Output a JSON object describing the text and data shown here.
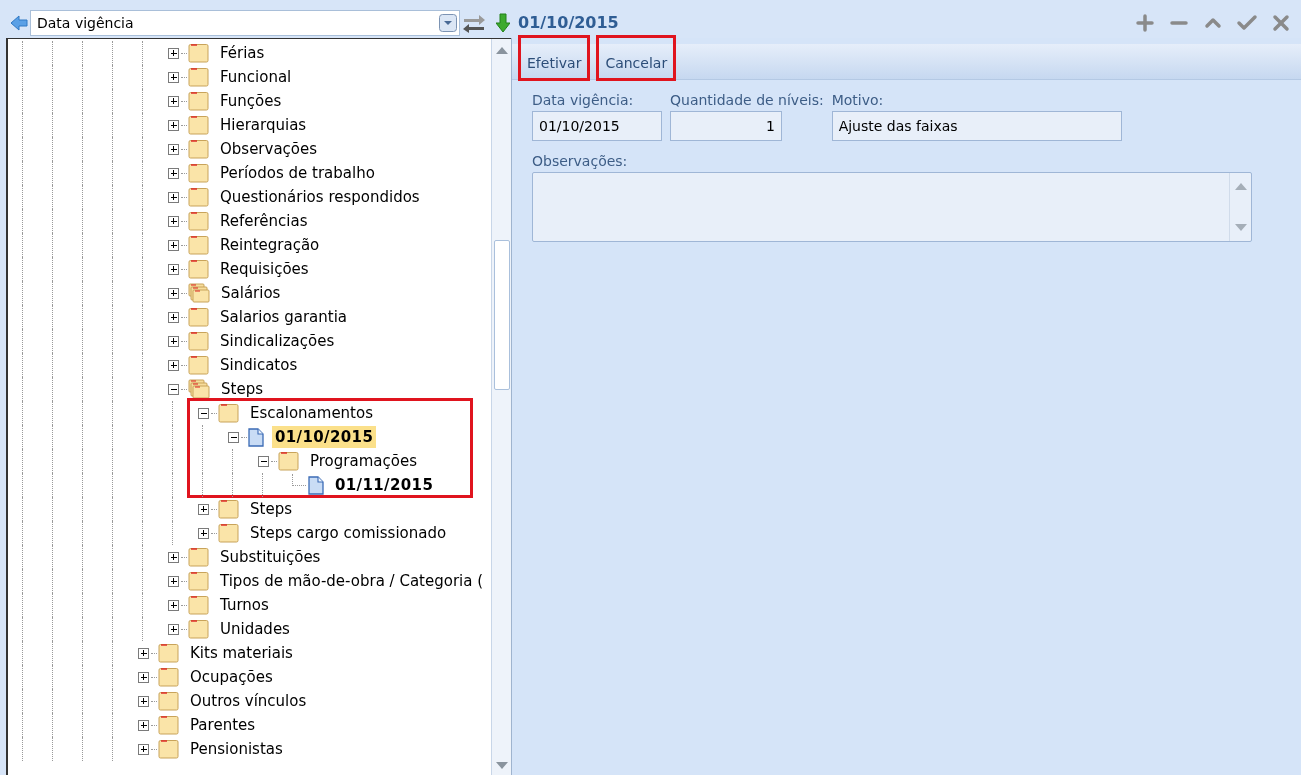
{
  "top_bar": {
    "combo_value": "Data vigência",
    "record_title": "01/10/2015"
  },
  "tree": {
    "continued_children": [
      {
        "label": "Férias",
        "kind": "folder",
        "expanded": false,
        "selected": false
      },
      {
        "label": "Funcional",
        "kind": "folder",
        "expanded": false,
        "selected": false
      },
      {
        "label": "Funções",
        "kind": "folder",
        "expanded": false,
        "selected": false
      },
      {
        "label": "Hierarquias",
        "kind": "folder",
        "expanded": false,
        "selected": false
      },
      {
        "label": "Observações",
        "kind": "folder",
        "expanded": false,
        "selected": false
      },
      {
        "label": "Períodos de trabalho",
        "kind": "folder",
        "expanded": false,
        "selected": false
      },
      {
        "label": "Questionários respondidos",
        "kind": "folder",
        "expanded": false,
        "selected": false
      },
      {
        "label": "Referências",
        "kind": "folder",
        "expanded": false,
        "selected": false
      },
      {
        "label": "Reintegração",
        "kind": "folder",
        "expanded": false,
        "selected": false
      },
      {
        "label": "Requisições",
        "kind": "folder",
        "expanded": false,
        "selected": false
      },
      {
        "label": "Salários",
        "kind": "folders",
        "expanded": false,
        "selected": false
      },
      {
        "label": "Salarios garantia",
        "kind": "folder",
        "expanded": false,
        "selected": false
      },
      {
        "label": "Sindicalizações",
        "kind": "folder",
        "expanded": false,
        "selected": false
      },
      {
        "label": "Sindicatos",
        "kind": "folder",
        "expanded": false,
        "selected": false
      },
      {
        "label": "Steps",
        "kind": "folders",
        "expanded": true,
        "selected": false,
        "children": [
          {
            "label": "Escalonamentos",
            "kind": "folder",
            "expanded": true,
            "selected": false,
            "annotated": true,
            "children": [
              {
                "label": "01/10/2015",
                "kind": "document",
                "expanded": true,
                "selected": true,
                "children": [
                  {
                    "label": "Programações",
                    "kind": "folder",
                    "expanded": true,
                    "selected": false,
                    "children": [
                      {
                        "label": "01/11/2015",
                        "kind": "document",
                        "selected": false
                      }
                    ]
                  }
                ]
              }
            ]
          },
          {
            "label": "Steps",
            "kind": "folder",
            "expanded": false,
            "selected": false
          },
          {
            "label": "Steps cargo comissionado",
            "kind": "folder",
            "expanded": false,
            "selected": false
          }
        ]
      },
      {
        "label": "Substituições",
        "kind": "folder",
        "expanded": false,
        "selected": false
      },
      {
        "label": "Tipos de mão-de-obra / Categoria (",
        "kind": "folder",
        "expanded": false,
        "selected": false
      },
      {
        "label": "Turnos",
        "kind": "folder",
        "expanded": false,
        "selected": false
      },
      {
        "label": "Unidades",
        "kind": "folder",
        "expanded": false,
        "selected": false
      }
    ],
    "items": [
      {
        "label": "Kits materiais",
        "kind": "folder",
        "expanded": false,
        "selected": false
      },
      {
        "label": "Ocupações",
        "kind": "folder",
        "expanded": false,
        "selected": false
      },
      {
        "label": "Outros vínculos",
        "kind": "folder",
        "expanded": false,
        "selected": false
      },
      {
        "label": "Parentes",
        "kind": "folder",
        "expanded": false,
        "selected": false
      },
      {
        "label": "Pensionistas",
        "kind": "folder",
        "expanded": false,
        "selected": false
      }
    ]
  },
  "toolbar": {
    "buttons": [
      {
        "label": "Efetivar",
        "highlighted": true
      },
      {
        "label": "Cancelar",
        "highlighted": true
      }
    ]
  },
  "form": {
    "fields": [
      {
        "label": "Data vigência:",
        "value": "01/10/2015",
        "kind": "text"
      },
      {
        "label": "Quantidade de níveis:",
        "value": "1",
        "kind": "number"
      },
      {
        "label": "Motivo:",
        "value": "Ajuste das faixas",
        "kind": "text"
      }
    ],
    "notes": {
      "label": "Observações:"
    }
  }
}
